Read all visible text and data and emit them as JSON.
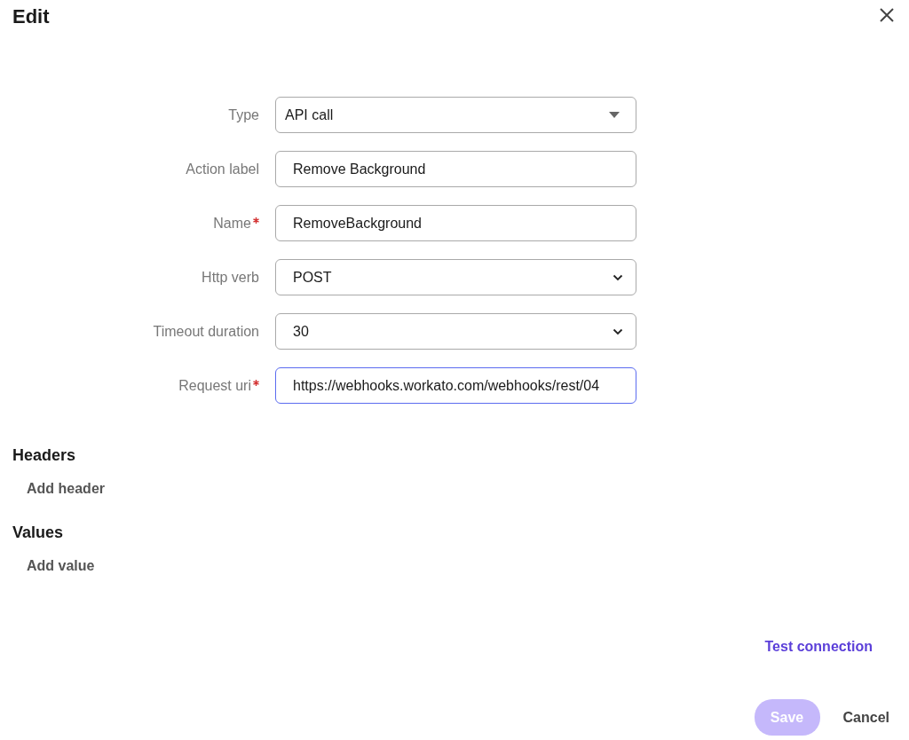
{
  "dialog": {
    "title": "Edit"
  },
  "fields": [
    {
      "label": "Type",
      "kind": "dropdown",
      "value": "API call",
      "required": false,
      "focused": false
    },
    {
      "label": "Action label",
      "kind": "text",
      "value": "Remove Background",
      "required": false,
      "focused": false
    },
    {
      "label": "Name",
      "kind": "text",
      "value": "RemoveBackground",
      "required": true,
      "focused": false
    },
    {
      "label": "Http verb",
      "kind": "select",
      "value": "POST",
      "required": false,
      "focused": false
    },
    {
      "label": "Timeout duration",
      "kind": "select",
      "value": "30",
      "required": false,
      "focused": false
    },
    {
      "label": "Request uri",
      "kind": "text",
      "value": "https://webhooks.workato.com/webhooks/rest/04",
      "required": true,
      "focused": true
    }
  ],
  "sections": [
    {
      "heading": "Headers",
      "action": "Add header"
    },
    {
      "heading": "Values",
      "action": "Add value"
    }
  ],
  "test_link": "Test connection",
  "buttons": [
    {
      "label": "Save",
      "kind": "primary",
      "disabled": true
    },
    {
      "label": "Cancel",
      "kind": "secondary",
      "disabled": false
    }
  ]
}
